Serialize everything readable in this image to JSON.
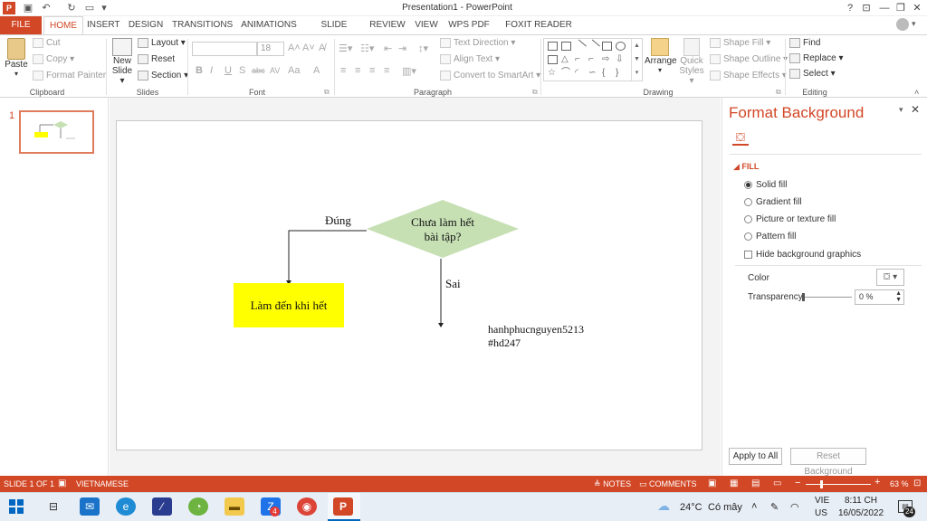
{
  "window": {
    "title": "Presentation1 - PowerPoint",
    "controls": [
      "?",
      "⊡",
      "—",
      "❐",
      "✕"
    ]
  },
  "tabs": [
    "FILE",
    "HOME",
    "INSERT",
    "DESIGN",
    "TRANSITIONS",
    "ANIMATIONS",
    "SLIDE SHOW",
    "REVIEW",
    "VIEW",
    "WPS PDF",
    "FOXIT READER PDF"
  ],
  "ribbon": {
    "clipboard": {
      "paste": "Paste",
      "cut": "Cut",
      "copy": "Copy",
      "format_painter": "Format Painter",
      "label": "Clipboard"
    },
    "slides": {
      "new_slide": "New",
      "new_slide2": "Slide",
      "layout": "Layout",
      "reset": "Reset",
      "section": "Section",
      "label": "Slides"
    },
    "font": {
      "size": "18",
      "label": "Font",
      "buttons": [
        "B",
        "I",
        "U",
        "S",
        "abc",
        "AV",
        "Aa",
        "A"
      ]
    },
    "paragraph": {
      "text_direction": "Text Direction",
      "align_text": "Align Text",
      "convert_smartart": "Convert to SmartArt",
      "label": "Paragraph"
    },
    "drawing": {
      "arrange": "Arrange",
      "quick_styles": "Quick",
      "quick_styles2": "Styles",
      "shape_fill": "Shape Fill",
      "shape_outline": "Shape Outline",
      "shape_effects": "Shape Effects",
      "label": "Drawing"
    },
    "editing": {
      "find": "Find",
      "replace": "Replace",
      "select": "Select",
      "label": "Editing"
    }
  },
  "thumbnail": {
    "number": "1"
  },
  "slide": {
    "diamond_text_line1": "Chưa làm hết",
    "diamond_text_line2": "bài tập?",
    "yes_label": "Đúng",
    "no_label": "Sai",
    "box_text": "Làm đến khi hết",
    "watermark_line1": "hanhphucnguyen5213",
    "watermark_line2": "#hd247",
    "colors": {
      "diamond": "#c6e0b4",
      "box": "#ffff00"
    }
  },
  "format_background": {
    "title": "Format Background",
    "section": "FILL",
    "options": {
      "solid": "Solid fill",
      "gradient": "Gradient fill",
      "picture": "Picture or texture fill",
      "pattern": "Pattern fill"
    },
    "hide_graphics": "Hide background graphics",
    "color_label": "Color",
    "transparency_label": "Transparency",
    "transparency_value": "0 %",
    "apply_all": "Apply to All",
    "reset": "Reset Background"
  },
  "statusbar": {
    "slide_info": "SLIDE 1 OF 1",
    "language": "VIETNAMESE",
    "notes": "NOTES",
    "comments": "COMMENTS",
    "zoom_plus": "+",
    "zoom": "63 %"
  },
  "taskbar": {
    "weather": "24°C",
    "weather_desc": "Có mây",
    "lang1": "VIE",
    "lang2": "US",
    "time": "8:11 CH",
    "date": "16/05/2022",
    "badge_zalo": "4",
    "notif_count": "24"
  },
  "accent_color": "#d24726"
}
